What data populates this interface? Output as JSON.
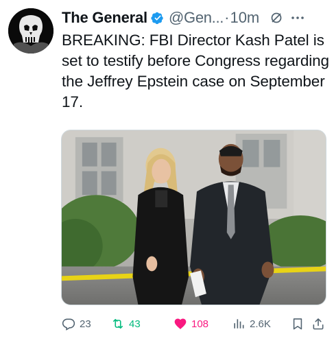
{
  "author": {
    "name": "The General",
    "handle": "@Gen...",
    "separator": "·",
    "time": "10m"
  },
  "tweet": {
    "text": "BREAKING: FBI Director Kash Patel is set to testify before Congress regarding the Jeffrey Epstein case on September 17."
  },
  "media": {
    "description_icon": "photo"
  },
  "actions": {
    "replies": "23",
    "reposts": "43",
    "likes": "108",
    "views": "2.6K"
  },
  "colors": {
    "verified": "#1d9bf0",
    "repost": "#00ba7c",
    "like": "#f91880",
    "muted": "#536471"
  },
  "icons": [
    "punisher-skull-avatar",
    "verified-badge-icon",
    "grok-icon",
    "more-icon",
    "reply-icon",
    "repost-icon",
    "like-icon",
    "views-icon",
    "bookmark-icon",
    "share-icon"
  ]
}
